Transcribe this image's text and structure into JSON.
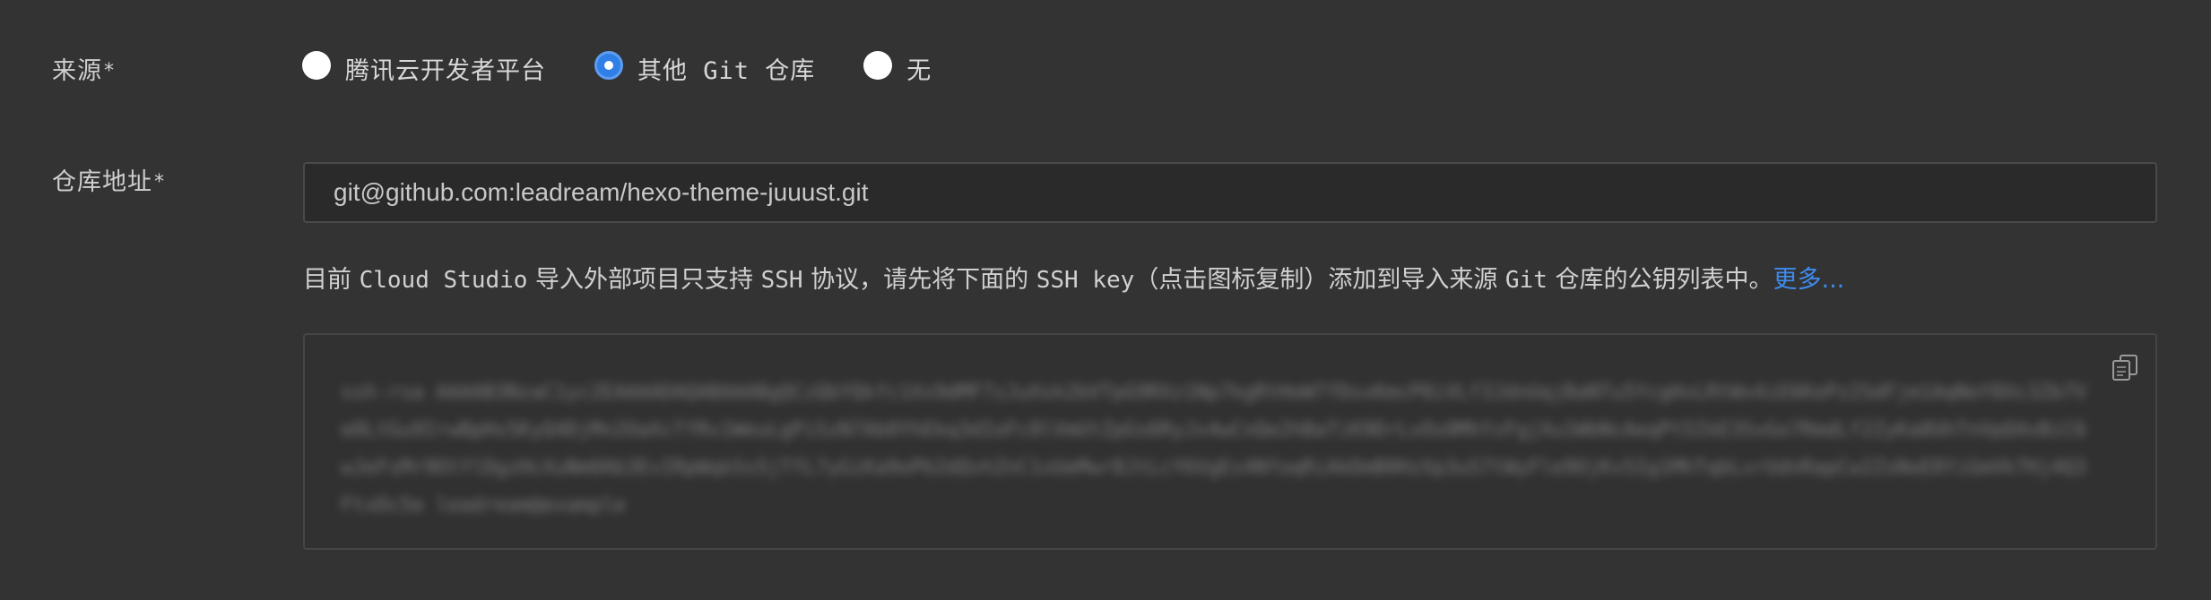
{
  "form": {
    "source": {
      "label": "来源",
      "required_mark": "*",
      "options": [
        {
          "label": "腾讯云开发者平台",
          "checked": false
        },
        {
          "label": "其他 Git 仓库",
          "checked": true
        },
        {
          "label": "无",
          "checked": false
        }
      ]
    },
    "repo": {
      "label": "仓库地址",
      "required_mark": "*",
      "value": "git@github.com:leadream/hexo-theme-juuust.git"
    },
    "hint": {
      "part1": "目前 ",
      "part2": "Cloud Studio",
      "part3": " 导入外部项目只支持 ",
      "part4": "SSH",
      "part5": " 协议，请先将下面的 ",
      "part6": "SSH key",
      "part7": "（点击图标复制）添加到导入来源 ",
      "part8": "Git",
      "part9": " 仓库的公钥列表中。",
      "more_link": "更多..."
    },
    "ssh_key": {
      "copy_icon": "copy-icon"
    }
  },
  "colors": {
    "background": "#333333",
    "accent": "#3d8cf0",
    "radio_checked": "#2f7fe6"
  }
}
